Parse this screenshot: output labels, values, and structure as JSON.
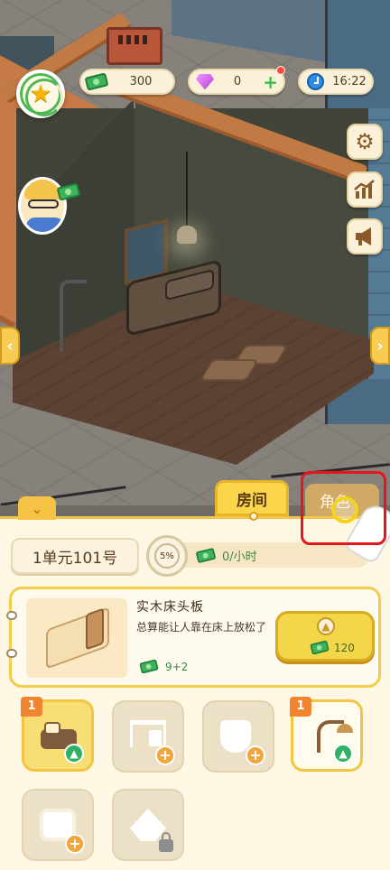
{
  "hud": {
    "cash": "300",
    "gems": "0",
    "time": "16:22",
    "icons": {
      "level": "star-icon",
      "cash": "cash-icon",
      "gem": "gem-icon",
      "add": "plus-icon",
      "clock": "clock-icon",
      "settings": "gear-icon",
      "stats": "chart-icon",
      "announce": "megaphone-icon"
    }
  },
  "tabs": {
    "room": "房间",
    "role": "角色"
  },
  "panel": {
    "unit": "1单元101号",
    "progress": "5%",
    "income": "0/小时"
  },
  "item": {
    "name": "实木床头板",
    "description": "总算能让人靠在床上放松了",
    "stat": "9+2",
    "cost": "120"
  },
  "slots": [
    {
      "name": "bed",
      "badge": "1",
      "state": "upgrade"
    },
    {
      "name": "desk",
      "badge": "",
      "state": "add"
    },
    {
      "name": "toilet",
      "badge": "",
      "state": "add"
    },
    {
      "name": "shower",
      "badge": "1",
      "state": "upgrade"
    },
    {
      "name": "tv",
      "badge": "",
      "state": "add"
    },
    {
      "name": "lamp",
      "badge": "",
      "state": "locked"
    }
  ],
  "colors": {
    "panel_bg": "#fdf7e4",
    "accent_yellow": "#f4d64a",
    "cash_green": "#3fb25a",
    "highlight_red": "#e5161b"
  }
}
